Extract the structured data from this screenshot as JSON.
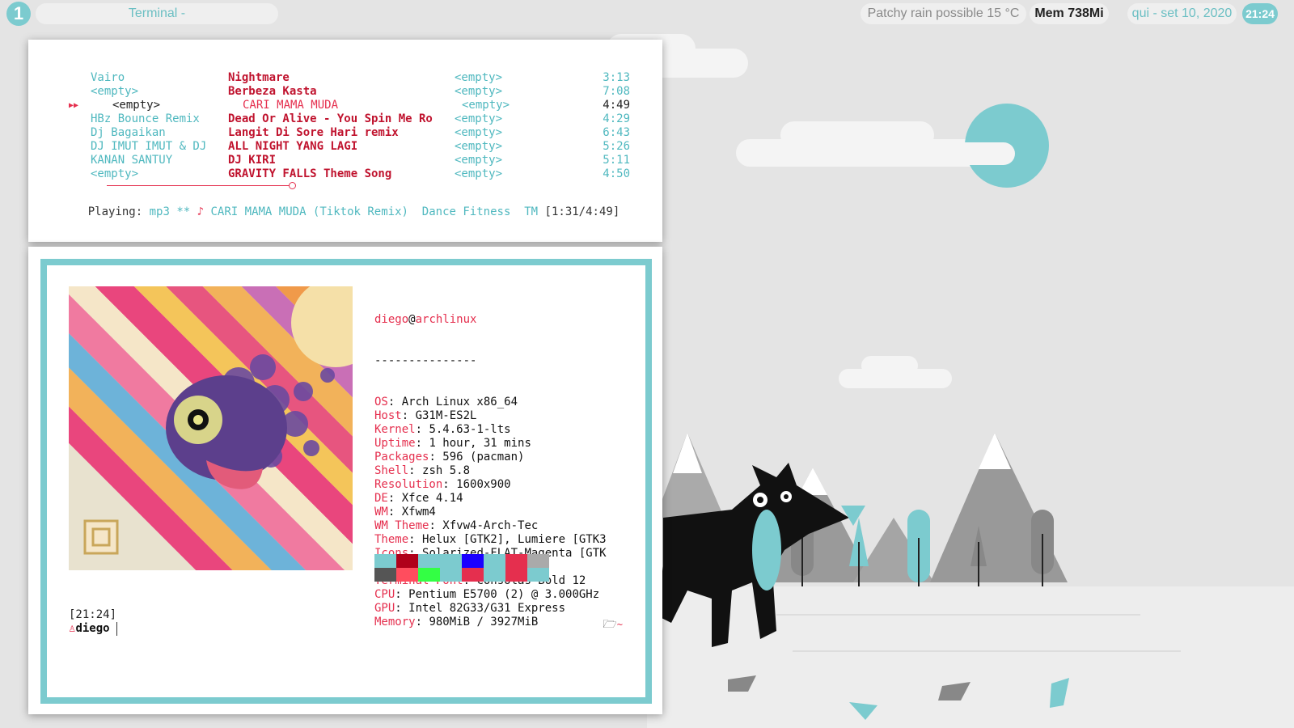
{
  "topbar": {
    "workspace": "1",
    "window_title": "Terminal -",
    "weather": "Patchy rain possible 15 °C",
    "memory": "Mem 738Mi",
    "date": "qui - set 10, 2020",
    "clock": "21:24"
  },
  "player": {
    "tracks": [
      {
        "artist": "Vairo",
        "title": "Nightmare",
        "album": "<empty>",
        "time": "3:13"
      },
      {
        "artist": "<empty>",
        "title": "Berbeza Kasta",
        "album": "<empty>",
        "time": "7:08"
      },
      {
        "artist": "<empty>",
        "title": "CARI MAMA MUDA",
        "album": "<empty>",
        "time": "4:49",
        "current": true
      },
      {
        "artist": "HBz Bounce Remix",
        "title": "Dead Or Alive - You Spin Me Ro",
        "album": "<empty>",
        "time": "4:29"
      },
      {
        "artist": "Dj Bagaikan",
        "title": "Langit Di Sore Hari remix",
        "album": "<empty>",
        "time": "6:43"
      },
      {
        "artist": "DJ IMUT IMUT & DJ",
        "title": "ALL NIGHT YANG LAGI",
        "album": "<empty>",
        "time": "5:26"
      },
      {
        "artist": "KANAN SANTUY",
        "title": "DJ KIRI",
        "album": "<empty>",
        "time": "5:11"
      },
      {
        "artist": "<empty>",
        "title": "GRAVITY FALLS Theme Song",
        "album": "<empty>",
        "time": "4:50"
      }
    ],
    "play_marker": "▶▶",
    "progress_fraction": 0.31,
    "status": {
      "label": "Playing:",
      "format": "mp3",
      "flags": "**",
      "note_icon": "♪",
      "track": "CARI MAMA MUDA (Tiktok Remix)",
      "extra": "Dance Fitness",
      "mode": "TM",
      "position": "[1:31/4:49]"
    }
  },
  "terminal": {
    "user": "diego",
    "at": "@",
    "host": "archlinux",
    "separator": "---------------",
    "info": [
      {
        "key": "OS",
        "value": "Arch Linux x86_64"
      },
      {
        "key": "Host",
        "value": "G31M-ES2L"
      },
      {
        "key": "Kernel",
        "value": "5.4.63-1-lts"
      },
      {
        "key": "Uptime",
        "value": "1 hour, 31 mins"
      },
      {
        "key": "Packages",
        "value": "596 (pacman)"
      },
      {
        "key": "Shell",
        "value": "zsh 5.8"
      },
      {
        "key": "Resolution",
        "value": "1600x900"
      },
      {
        "key": "DE",
        "value": "Xfce 4.14"
      },
      {
        "key": "WM",
        "value": "Xfwm4"
      },
      {
        "key": "WM Theme",
        "value": "Xfvw4-Arch-Tec"
      },
      {
        "key": "Theme",
        "value": "Helux [GTK2], Lumiere [GTK3"
      },
      {
        "key": "Icons",
        "value": "Solarized-FLAT-Magenta [GTK"
      },
      {
        "key": "Terminal",
        "value": "xfce4-terminal"
      },
      {
        "key": "Terminal Font",
        "value": "Consolas Bold 12"
      },
      {
        "key": "CPU",
        "value": "Pentium E5700 (2) @ 3.000GHz"
      },
      {
        "key": "GPU",
        "value": "Intel 82G33/G31 Express"
      },
      {
        "key": "Memory",
        "value": "980MiB / 3927MiB"
      }
    ],
    "swatches_top": [
      "#7ccbcf",
      "#b0001a",
      "#7ccbcf",
      "#7ccbcf",
      "#1a00ff",
      "#7ccbcf",
      "#e52f4e",
      "#aaaaaa"
    ],
    "swatches_bottom": [
      "#555555",
      "#ff4d5e",
      "#33ff44",
      "#7ccbcf",
      "#e52f4e",
      "#7ccbcf",
      "#e52f4e",
      "#7ccbcf"
    ],
    "prompt_time": "[21:24]",
    "prompt_user": "diego",
    "user_icon": "♙",
    "folder_icon": "folder-open-icon",
    "folder_glyph": "🗁",
    "tilde": "~"
  },
  "colors": {
    "accent_teal": "#7ccbcf",
    "accent_red": "#e52f4e",
    "dark_red": "#c0132e"
  }
}
